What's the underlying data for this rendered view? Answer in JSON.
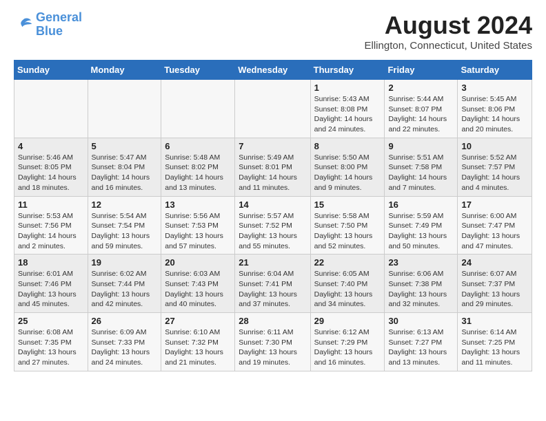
{
  "logo": {
    "line1": "General",
    "line2": "Blue"
  },
  "title": "August 2024",
  "location": "Ellington, Connecticut, United States",
  "days_of_week": [
    "Sunday",
    "Monday",
    "Tuesday",
    "Wednesday",
    "Thursday",
    "Friday",
    "Saturday"
  ],
  "weeks": [
    [
      {
        "day": "",
        "info": ""
      },
      {
        "day": "",
        "info": ""
      },
      {
        "day": "",
        "info": ""
      },
      {
        "day": "",
        "info": ""
      },
      {
        "day": "1",
        "info": "Sunrise: 5:43 AM\nSunset: 8:08 PM\nDaylight: 14 hours\nand 24 minutes."
      },
      {
        "day": "2",
        "info": "Sunrise: 5:44 AM\nSunset: 8:07 PM\nDaylight: 14 hours\nand 22 minutes."
      },
      {
        "day": "3",
        "info": "Sunrise: 5:45 AM\nSunset: 8:06 PM\nDaylight: 14 hours\nand 20 minutes."
      }
    ],
    [
      {
        "day": "4",
        "info": "Sunrise: 5:46 AM\nSunset: 8:05 PM\nDaylight: 14 hours\nand 18 minutes."
      },
      {
        "day": "5",
        "info": "Sunrise: 5:47 AM\nSunset: 8:04 PM\nDaylight: 14 hours\nand 16 minutes."
      },
      {
        "day": "6",
        "info": "Sunrise: 5:48 AM\nSunset: 8:02 PM\nDaylight: 14 hours\nand 13 minutes."
      },
      {
        "day": "7",
        "info": "Sunrise: 5:49 AM\nSunset: 8:01 PM\nDaylight: 14 hours\nand 11 minutes."
      },
      {
        "day": "8",
        "info": "Sunrise: 5:50 AM\nSunset: 8:00 PM\nDaylight: 14 hours\nand 9 minutes."
      },
      {
        "day": "9",
        "info": "Sunrise: 5:51 AM\nSunset: 7:58 PM\nDaylight: 14 hours\nand 7 minutes."
      },
      {
        "day": "10",
        "info": "Sunrise: 5:52 AM\nSunset: 7:57 PM\nDaylight: 14 hours\nand 4 minutes."
      }
    ],
    [
      {
        "day": "11",
        "info": "Sunrise: 5:53 AM\nSunset: 7:56 PM\nDaylight: 14 hours\nand 2 minutes."
      },
      {
        "day": "12",
        "info": "Sunrise: 5:54 AM\nSunset: 7:54 PM\nDaylight: 13 hours\nand 59 minutes."
      },
      {
        "day": "13",
        "info": "Sunrise: 5:56 AM\nSunset: 7:53 PM\nDaylight: 13 hours\nand 57 minutes."
      },
      {
        "day": "14",
        "info": "Sunrise: 5:57 AM\nSunset: 7:52 PM\nDaylight: 13 hours\nand 55 minutes."
      },
      {
        "day": "15",
        "info": "Sunrise: 5:58 AM\nSunset: 7:50 PM\nDaylight: 13 hours\nand 52 minutes."
      },
      {
        "day": "16",
        "info": "Sunrise: 5:59 AM\nSunset: 7:49 PM\nDaylight: 13 hours\nand 50 minutes."
      },
      {
        "day": "17",
        "info": "Sunrise: 6:00 AM\nSunset: 7:47 PM\nDaylight: 13 hours\nand 47 minutes."
      }
    ],
    [
      {
        "day": "18",
        "info": "Sunrise: 6:01 AM\nSunset: 7:46 PM\nDaylight: 13 hours\nand 45 minutes."
      },
      {
        "day": "19",
        "info": "Sunrise: 6:02 AM\nSunset: 7:44 PM\nDaylight: 13 hours\nand 42 minutes."
      },
      {
        "day": "20",
        "info": "Sunrise: 6:03 AM\nSunset: 7:43 PM\nDaylight: 13 hours\nand 40 minutes."
      },
      {
        "day": "21",
        "info": "Sunrise: 6:04 AM\nSunset: 7:41 PM\nDaylight: 13 hours\nand 37 minutes."
      },
      {
        "day": "22",
        "info": "Sunrise: 6:05 AM\nSunset: 7:40 PM\nDaylight: 13 hours\nand 34 minutes."
      },
      {
        "day": "23",
        "info": "Sunrise: 6:06 AM\nSunset: 7:38 PM\nDaylight: 13 hours\nand 32 minutes."
      },
      {
        "day": "24",
        "info": "Sunrise: 6:07 AM\nSunset: 7:37 PM\nDaylight: 13 hours\nand 29 minutes."
      }
    ],
    [
      {
        "day": "25",
        "info": "Sunrise: 6:08 AM\nSunset: 7:35 PM\nDaylight: 13 hours\nand 27 minutes."
      },
      {
        "day": "26",
        "info": "Sunrise: 6:09 AM\nSunset: 7:33 PM\nDaylight: 13 hours\nand 24 minutes."
      },
      {
        "day": "27",
        "info": "Sunrise: 6:10 AM\nSunset: 7:32 PM\nDaylight: 13 hours\nand 21 minutes."
      },
      {
        "day": "28",
        "info": "Sunrise: 6:11 AM\nSunset: 7:30 PM\nDaylight: 13 hours\nand 19 minutes."
      },
      {
        "day": "29",
        "info": "Sunrise: 6:12 AM\nSunset: 7:29 PM\nDaylight: 13 hours\nand 16 minutes."
      },
      {
        "day": "30",
        "info": "Sunrise: 6:13 AM\nSunset: 7:27 PM\nDaylight: 13 hours\nand 13 minutes."
      },
      {
        "day": "31",
        "info": "Sunrise: 6:14 AM\nSunset: 7:25 PM\nDaylight: 13 hours\nand 11 minutes."
      }
    ]
  ]
}
